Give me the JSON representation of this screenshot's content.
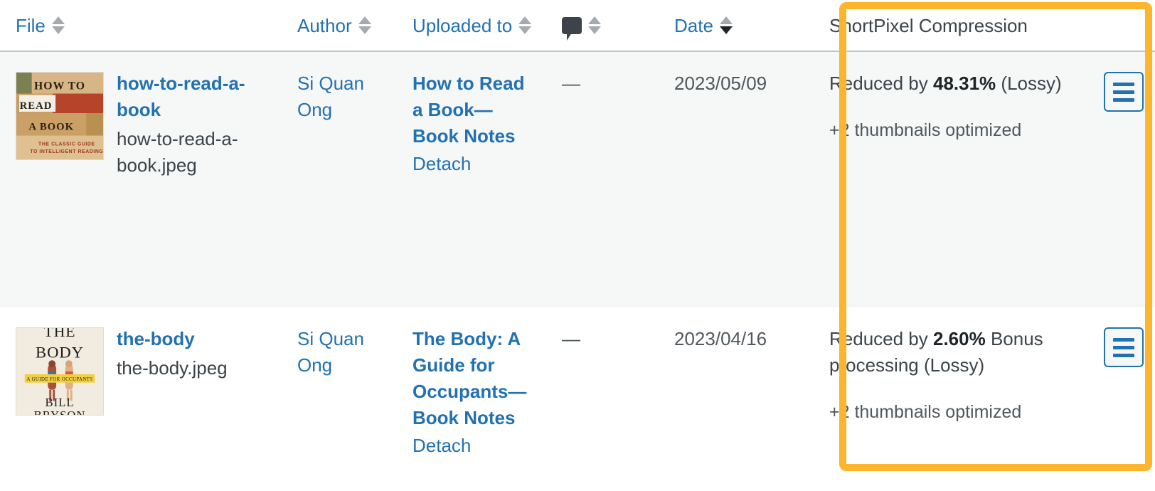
{
  "table": {
    "columns": [
      {
        "key": "file",
        "label": "File",
        "sortable": true,
        "sort": "none",
        "type": "text"
      },
      {
        "key": "author",
        "label": "Author",
        "sortable": true,
        "sort": "none",
        "type": "text"
      },
      {
        "key": "uploaded",
        "label": "Uploaded to",
        "sortable": true,
        "sort": "none",
        "type": "text"
      },
      {
        "key": "comments",
        "label": "",
        "sortable": true,
        "sort": "none",
        "type": "icon",
        "icon": "comment-bubble-icon"
      },
      {
        "key": "date",
        "label": "Date",
        "sortable": true,
        "sort": "desc",
        "type": "text"
      },
      {
        "key": "shortpixel",
        "label": "ShortPixel Compression",
        "sortable": false,
        "sort": "none",
        "type": "text"
      }
    ],
    "rows": [
      {
        "thumbnail_alt": "How to Read a Book cover",
        "file_title": "how-to-read-a-book",
        "file_name": "how-to-read-a-book.jpeg",
        "author": "Si Quan Ong",
        "uploaded_to": "How to Read a Book—Book Notes",
        "detach_label": "Detach",
        "comments": "—",
        "date": "2023/05/09",
        "shortpixel": {
          "reduced_prefix": "Reduced by ",
          "reduced_percent": "48.31%",
          "reduced_suffix": "(Lossy)",
          "bonus_processing": "",
          "thumbnails_note": "+2 thumbnails optimized",
          "menu_button_label": "ShortPixel options menu"
        }
      },
      {
        "thumbnail_alt": "The Body: A Guide for Occupants cover",
        "file_title": "the-body",
        "file_name": "the-body.jpeg",
        "author": "Si Quan Ong",
        "uploaded_to": "The Body: A Guide for Occupants—Book Notes",
        "detach_label": "Detach",
        "comments": "—",
        "date": "2023/04/16",
        "shortpixel": {
          "reduced_prefix": "Reduced by ",
          "reduced_percent": "2.60%",
          "reduced_suffix": "(Lossy)",
          "bonus_processing": "Bonus processing",
          "thumbnails_note": "+2 thumbnails optimized",
          "menu_button_label": "ShortPixel options menu"
        }
      }
    ]
  },
  "highlight": {
    "target": "shortpixel-column",
    "color": "#fcb52d"
  },
  "colors": {
    "link": "#2271b1",
    "text": "#3c434a",
    "muted": "#50575e",
    "row_alt_bg": "#f6f7f7",
    "header_border": "#c3c4c7",
    "highlight": "#fcb52d"
  },
  "covers": {
    "how_to_read_a_book": {
      "line1": "HOW TO",
      "line2": "READ",
      "line3": "A BOOK",
      "sub1": "THE CLASSIC GUIDE",
      "sub2": "TO INTELLIGENT READING"
    },
    "the_body": {
      "line1": "THE",
      "line2": "BODY",
      "band": "A GUIDE FOR OCCUPANTS",
      "line3": "BILL",
      "line4": "BRYSON"
    }
  }
}
